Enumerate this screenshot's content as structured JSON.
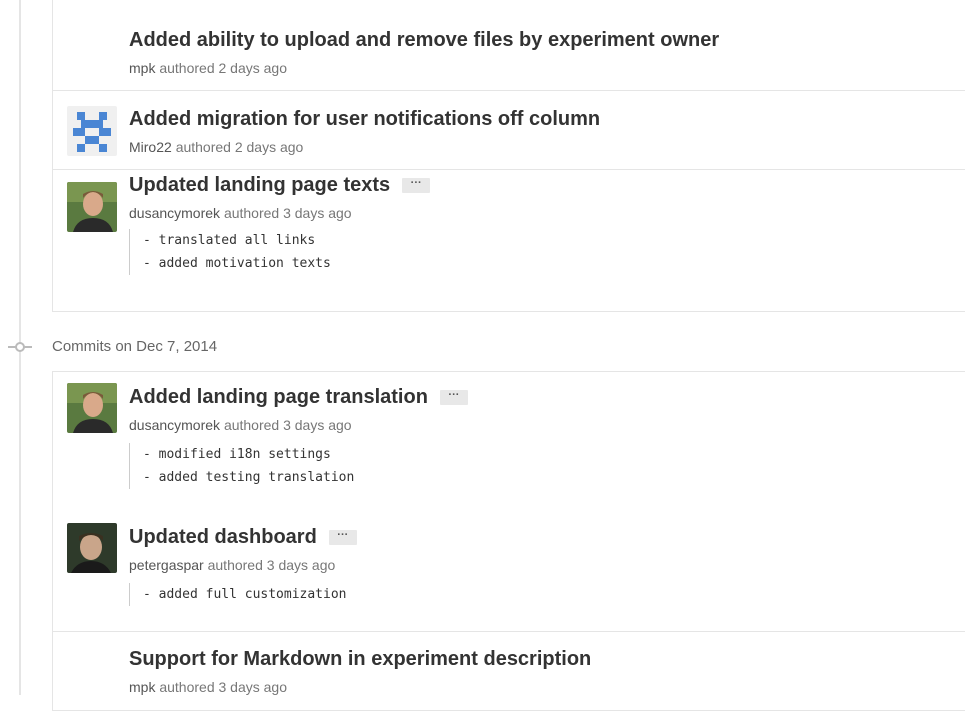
{
  "groups": [
    {
      "commits": [
        {
          "title": "Added ability to upload and remove files by experiment owner",
          "author": "mpk",
          "time": "authored 2 days ago",
          "avatar": "none",
          "lines": []
        },
        {
          "title": "Added migration for user notifications off column",
          "author": "Miro22",
          "time": "authored 2 days ago",
          "avatar": "identicon",
          "lines": []
        },
        {
          "title": "Updated landing page texts",
          "author": "dusancymorek",
          "time": "authored 3 days ago",
          "avatar": "photo",
          "lines": [
            "- translated all links",
            "- added motivation texts"
          ]
        }
      ]
    },
    {
      "date_label": "Commits on Dec 7, 2014",
      "commits": [
        {
          "title": "Added landing page translation",
          "author": "dusancymorek",
          "time": "authored 3 days ago",
          "avatar": "photo",
          "lines": [
            "- modified i18n settings",
            "- added testing translation"
          ]
        },
        {
          "title": "Updated dashboard",
          "author": "petergaspar",
          "time": "authored 3 days ago",
          "avatar": "photo",
          "lines": [
            "- added full customization"
          ]
        },
        {
          "title": "Support for Markdown in experiment description",
          "author": "mpk",
          "time": "authored 3 days ago",
          "avatar": "none",
          "lines": []
        }
      ]
    }
  ],
  "expand_label": "···",
  "icons": {
    "commit_node": "git-commit-icon",
    "expand": "ellipsis-icon"
  },
  "colors": {
    "border": "#e5e5e5",
    "title": "#333333",
    "meta": "#777777",
    "identicon": "#4a86d4"
  }
}
